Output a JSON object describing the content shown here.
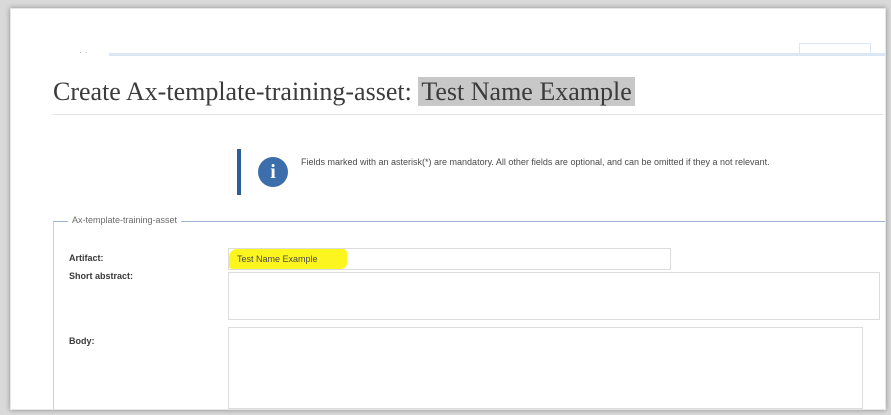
{
  "page": {
    "title_prefix": "Create Ax-template-training-asset:",
    "title_name": "Test Name Example"
  },
  "topnav": {
    "dots": "· ·"
  },
  "info": {
    "icon": "info-icon",
    "text": "Fields marked with an asterisk(*) are mandatory. All other fields are optional, and can be omitted if they a not relevant."
  },
  "form": {
    "legend": "Ax-template-training-asset",
    "artifact_label": "Artifact:",
    "artifact_value": "Test Name Example",
    "short_abstract_label": "Short abstract:",
    "short_abstract_value": "",
    "body_label": "Body:",
    "body_value": ""
  },
  "colors": {
    "highlight": "#fcf51e",
    "accent": "#2e5e9a",
    "info_icon_bg": "#3c6eab"
  }
}
